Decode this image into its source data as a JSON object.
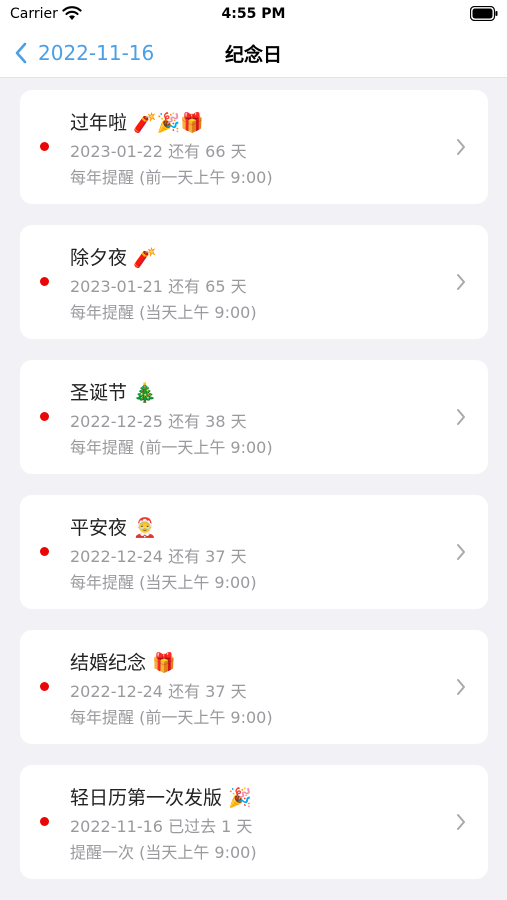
{
  "status_bar": {
    "carrier": "Carrier",
    "time": "4:55 PM",
    "icons": [
      "wifi-icon",
      "battery-icon"
    ]
  },
  "nav": {
    "back_label": "2022-11-16",
    "back_icon": "chevron-left-icon",
    "title": "纪念日",
    "accent_color": "#4a9fe6"
  },
  "events": [
    {
      "name": "过年啦 🧨🎉🎁",
      "date": "2023-01-22 还有 66 天",
      "reminder": "每年提醒 (前一天上午 9:00)"
    },
    {
      "name": "除夕夜 🧨",
      "date": "2023-01-21 还有 65 天",
      "reminder": "每年提醒 (当天上午 9:00)"
    },
    {
      "name": "圣诞节 🎄",
      "date": "2022-12-25 还有 38 天",
      "reminder": "每年提醒 (前一天上午 9:00)"
    },
    {
      "name": "平安夜 🤶",
      "date": "2022-12-24 还有 37 天",
      "reminder": "每年提醒 (当天上午 9:00)"
    },
    {
      "name": "结婚纪念 🎁",
      "date": "2022-12-24 还有 37 天",
      "reminder": "每年提醒 (前一天上午 9:00)"
    },
    {
      "name": "轻日历第一次发版 🎉",
      "date": "2022-11-16 已过去 1 天",
      "reminder": "提醒一次 (当天上午 9:00)"
    }
  ],
  "colors": {
    "dot": "#e90606",
    "background": "#f2f2f6",
    "secondary_text": "#9a9a9e"
  }
}
